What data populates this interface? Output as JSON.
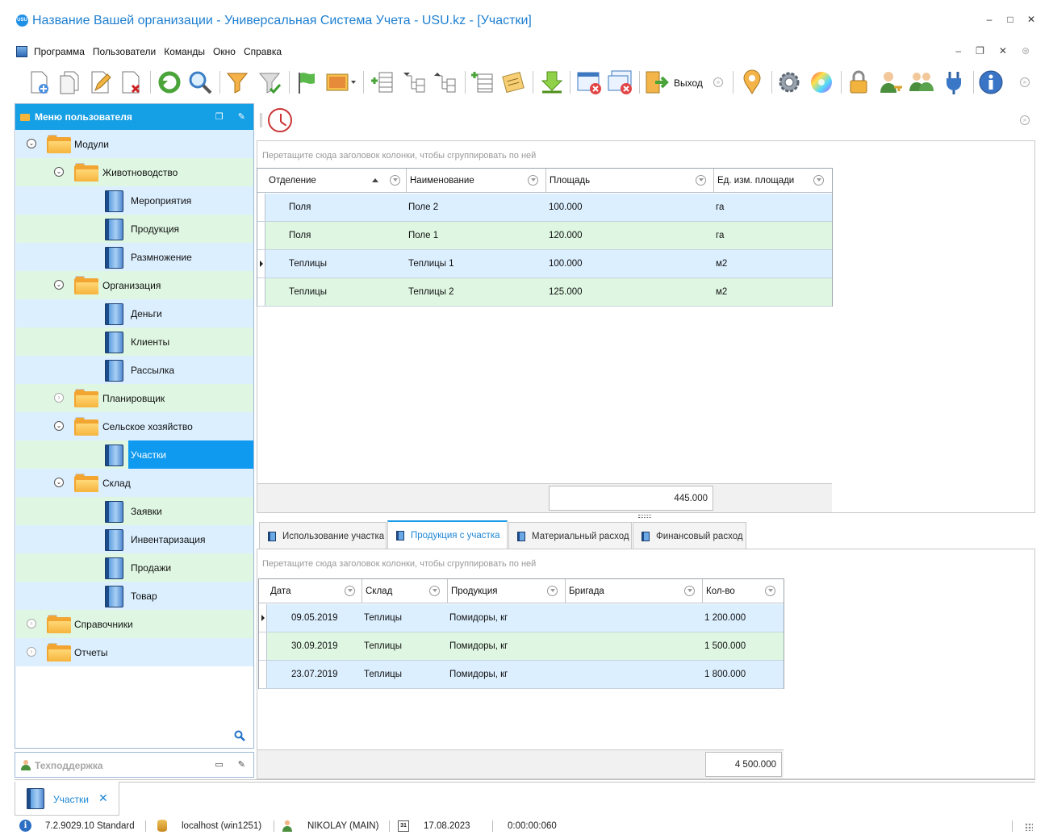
{
  "window": {
    "title": "Название Вашей организации - Универсальная Система Учета - USU.kz - [Участки]",
    "logo_text": "USU"
  },
  "menu": [
    "Программа",
    "Пользователи",
    "Команды",
    "Окно",
    "Справка"
  ],
  "toolbar": {
    "exit_label": "Выход"
  },
  "user_menu": {
    "title": "Меню пользователя",
    "items": [
      {
        "label": "Модули",
        "type": "folder",
        "level": 0
      },
      {
        "label": "Животноводство",
        "type": "folder",
        "level": 1
      },
      {
        "label": "Мероприятия",
        "type": "item",
        "level": 2
      },
      {
        "label": "Продукция",
        "type": "item",
        "level": 2
      },
      {
        "label": "Размножение",
        "type": "item",
        "level": 2
      },
      {
        "label": "Организация",
        "type": "folder",
        "level": 1
      },
      {
        "label": "Деньги",
        "type": "item",
        "level": 2
      },
      {
        "label": "Клиенты",
        "type": "item",
        "level": 2
      },
      {
        "label": "Рассылка",
        "type": "item",
        "level": 2
      },
      {
        "label": "Планировщик",
        "type": "folder",
        "level": 1
      },
      {
        "label": "Сельское хозяйство",
        "type": "folder",
        "level": 1
      },
      {
        "label": "Участки",
        "type": "item",
        "level": 2,
        "selected": true
      },
      {
        "label": "Склад",
        "type": "folder",
        "level": 1
      },
      {
        "label": "Заявки",
        "type": "item",
        "level": 2
      },
      {
        "label": "Инвентаризация",
        "type": "item",
        "level": 2
      },
      {
        "label": "Продажи",
        "type": "item",
        "level": 2
      },
      {
        "label": "Товар",
        "type": "item",
        "level": 2
      },
      {
        "label": "Справочники",
        "type": "folder",
        "level": 0
      },
      {
        "label": "Отчеты",
        "type": "folder",
        "level": 0
      }
    ]
  },
  "support": {
    "title": "Техподдержка"
  },
  "main_grid": {
    "group_hint": "Перетащите сюда заголовок колонки, чтобы сгруппировать по ней",
    "columns": [
      "Отделение",
      "Наименование",
      "Площадь",
      "Ед. изм. площади"
    ],
    "rows": [
      [
        "Поля",
        "Поле 2",
        "100.000",
        "га"
      ],
      [
        "Поля",
        "Поле 1",
        "120.000",
        "га"
      ],
      [
        "Теплицы",
        "Теплицы 1",
        "100.000",
        "м2"
      ],
      [
        "Теплицы",
        "Теплицы 2",
        "125.000",
        "м2"
      ]
    ],
    "total": "445.000"
  },
  "tabs": [
    {
      "label": "Использование участка",
      "active": false
    },
    {
      "label": "Продукция с участка",
      "active": true
    },
    {
      "label": "Материальный расход",
      "active": false
    },
    {
      "label": "Финансовый расход",
      "active": false
    }
  ],
  "detail_grid": {
    "group_hint": "Перетащите сюда заголовок колонки, чтобы сгруппировать по ней",
    "columns": [
      "Дата",
      "Склад",
      "Продукция",
      "Бригада",
      "Кол-во"
    ],
    "rows": [
      [
        "09.05.2019",
        "Теплицы",
        "Помидоры, кг",
        "",
        "1 200.000"
      ],
      [
        "30.09.2019",
        "Теплицы",
        "Помидоры, кг",
        "",
        "1 500.000"
      ],
      [
        "23.07.2019",
        "Теплицы",
        "Помидоры, кг",
        "",
        "1 800.000"
      ]
    ],
    "total": "4 500.000"
  },
  "doc_tab": {
    "label": "Участки"
  },
  "status": {
    "version": "7.2.9029.10 Standard",
    "server": "localhost (win1251)",
    "user": "NIKOLAY (MAIN)",
    "calendar_icon_text": "31",
    "date": "17.08.2023",
    "timer": "0:00:00:060"
  }
}
